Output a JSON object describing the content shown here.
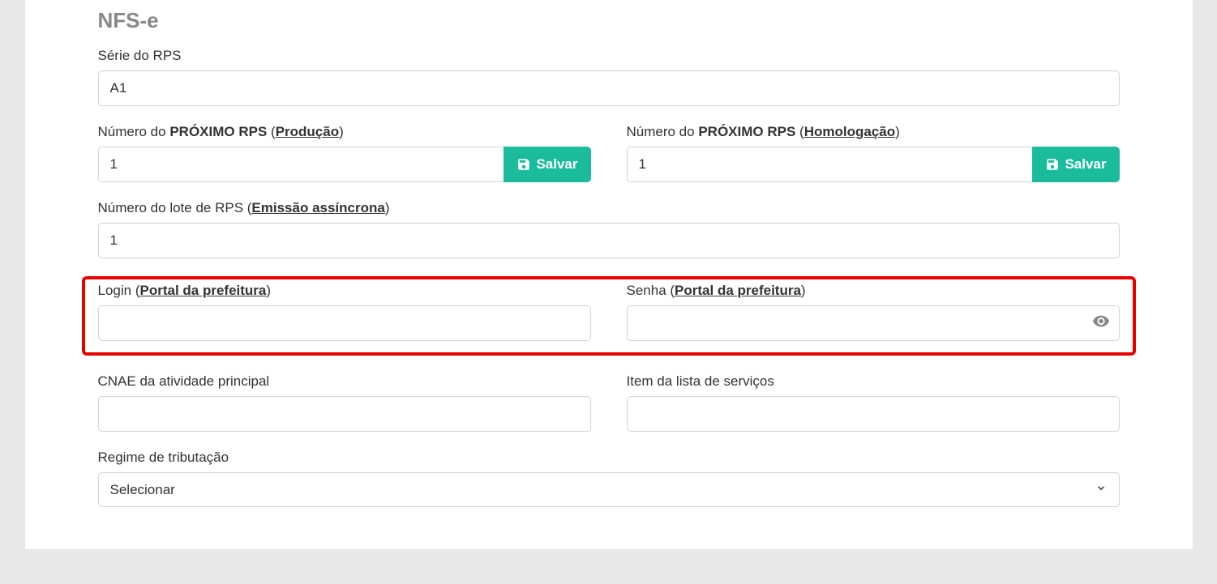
{
  "section_title": "NFS-e",
  "serie_rps": {
    "label": "Série do RPS",
    "value": "A1"
  },
  "proximo_rps_producao": {
    "label_prefix": "Número do ",
    "label_bold": "PRÓXIMO RPS",
    "label_paren_open": " (",
    "label_link": "Produção",
    "label_paren_close": ")",
    "value": "1",
    "save_label": "Salvar"
  },
  "proximo_rps_homolog": {
    "label_prefix": "Número do ",
    "label_bold": "PRÓXIMO RPS",
    "label_paren_open": " (",
    "label_link": "Homologação",
    "label_paren_close": ")",
    "value": "1",
    "save_label": "Salvar"
  },
  "lote_rps": {
    "label_prefix": "Número do lote de RPS (",
    "label_link": "Emissão assíncrona",
    "label_paren_close": ")",
    "value": "1"
  },
  "login": {
    "label_prefix": "Login (",
    "label_link": "Portal da prefeitura",
    "label_paren_close": ")",
    "value": ""
  },
  "senha": {
    "label_prefix": "Senha (",
    "label_link": "Portal da prefeitura",
    "label_paren_close": ")",
    "value": ""
  },
  "cnae": {
    "label": "CNAE da atividade principal",
    "value": ""
  },
  "item_lista": {
    "label": "Item da lista de serviços",
    "value": ""
  },
  "regime_tributacao": {
    "label": "Regime de tributação",
    "selected": "Selecionar"
  }
}
